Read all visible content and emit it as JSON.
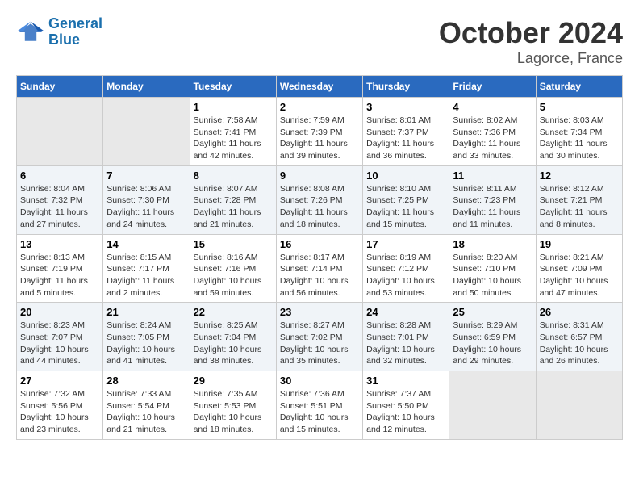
{
  "header": {
    "logo_line1": "General",
    "logo_line2": "Blue",
    "month": "October 2024",
    "location": "Lagorce, France"
  },
  "weekdays": [
    "Sunday",
    "Monday",
    "Tuesday",
    "Wednesday",
    "Thursday",
    "Friday",
    "Saturday"
  ],
  "weeks": [
    [
      {
        "day": "",
        "content": ""
      },
      {
        "day": "",
        "content": ""
      },
      {
        "day": "1",
        "content": "Sunrise: 7:58 AM\nSunset: 7:41 PM\nDaylight: 11 hours and 42 minutes."
      },
      {
        "day": "2",
        "content": "Sunrise: 7:59 AM\nSunset: 7:39 PM\nDaylight: 11 hours and 39 minutes."
      },
      {
        "day": "3",
        "content": "Sunrise: 8:01 AM\nSunset: 7:37 PM\nDaylight: 11 hours and 36 minutes."
      },
      {
        "day": "4",
        "content": "Sunrise: 8:02 AM\nSunset: 7:36 PM\nDaylight: 11 hours and 33 minutes."
      },
      {
        "day": "5",
        "content": "Sunrise: 8:03 AM\nSunset: 7:34 PM\nDaylight: 11 hours and 30 minutes."
      }
    ],
    [
      {
        "day": "6",
        "content": "Sunrise: 8:04 AM\nSunset: 7:32 PM\nDaylight: 11 hours and 27 minutes."
      },
      {
        "day": "7",
        "content": "Sunrise: 8:06 AM\nSunset: 7:30 PM\nDaylight: 11 hours and 24 minutes."
      },
      {
        "day": "8",
        "content": "Sunrise: 8:07 AM\nSunset: 7:28 PM\nDaylight: 11 hours and 21 minutes."
      },
      {
        "day": "9",
        "content": "Sunrise: 8:08 AM\nSunset: 7:26 PM\nDaylight: 11 hours and 18 minutes."
      },
      {
        "day": "10",
        "content": "Sunrise: 8:10 AM\nSunset: 7:25 PM\nDaylight: 11 hours and 15 minutes."
      },
      {
        "day": "11",
        "content": "Sunrise: 8:11 AM\nSunset: 7:23 PM\nDaylight: 11 hours and 11 minutes."
      },
      {
        "day": "12",
        "content": "Sunrise: 8:12 AM\nSunset: 7:21 PM\nDaylight: 11 hours and 8 minutes."
      }
    ],
    [
      {
        "day": "13",
        "content": "Sunrise: 8:13 AM\nSunset: 7:19 PM\nDaylight: 11 hours and 5 minutes."
      },
      {
        "day": "14",
        "content": "Sunrise: 8:15 AM\nSunset: 7:17 PM\nDaylight: 11 hours and 2 minutes."
      },
      {
        "day": "15",
        "content": "Sunrise: 8:16 AM\nSunset: 7:16 PM\nDaylight: 10 hours and 59 minutes."
      },
      {
        "day": "16",
        "content": "Sunrise: 8:17 AM\nSunset: 7:14 PM\nDaylight: 10 hours and 56 minutes."
      },
      {
        "day": "17",
        "content": "Sunrise: 8:19 AM\nSunset: 7:12 PM\nDaylight: 10 hours and 53 minutes."
      },
      {
        "day": "18",
        "content": "Sunrise: 8:20 AM\nSunset: 7:10 PM\nDaylight: 10 hours and 50 minutes."
      },
      {
        "day": "19",
        "content": "Sunrise: 8:21 AM\nSunset: 7:09 PM\nDaylight: 10 hours and 47 minutes."
      }
    ],
    [
      {
        "day": "20",
        "content": "Sunrise: 8:23 AM\nSunset: 7:07 PM\nDaylight: 10 hours and 44 minutes."
      },
      {
        "day": "21",
        "content": "Sunrise: 8:24 AM\nSunset: 7:05 PM\nDaylight: 10 hours and 41 minutes."
      },
      {
        "day": "22",
        "content": "Sunrise: 8:25 AM\nSunset: 7:04 PM\nDaylight: 10 hours and 38 minutes."
      },
      {
        "day": "23",
        "content": "Sunrise: 8:27 AM\nSunset: 7:02 PM\nDaylight: 10 hours and 35 minutes."
      },
      {
        "day": "24",
        "content": "Sunrise: 8:28 AM\nSunset: 7:01 PM\nDaylight: 10 hours and 32 minutes."
      },
      {
        "day": "25",
        "content": "Sunrise: 8:29 AM\nSunset: 6:59 PM\nDaylight: 10 hours and 29 minutes."
      },
      {
        "day": "26",
        "content": "Sunrise: 8:31 AM\nSunset: 6:57 PM\nDaylight: 10 hours and 26 minutes."
      }
    ],
    [
      {
        "day": "27",
        "content": "Sunrise: 7:32 AM\nSunset: 5:56 PM\nDaylight: 10 hours and 23 minutes."
      },
      {
        "day": "28",
        "content": "Sunrise: 7:33 AM\nSunset: 5:54 PM\nDaylight: 10 hours and 21 minutes."
      },
      {
        "day": "29",
        "content": "Sunrise: 7:35 AM\nSunset: 5:53 PM\nDaylight: 10 hours and 18 minutes."
      },
      {
        "day": "30",
        "content": "Sunrise: 7:36 AM\nSunset: 5:51 PM\nDaylight: 10 hours and 15 minutes."
      },
      {
        "day": "31",
        "content": "Sunrise: 7:37 AM\nSunset: 5:50 PM\nDaylight: 10 hours and 12 minutes."
      },
      {
        "day": "",
        "content": ""
      },
      {
        "day": "",
        "content": ""
      }
    ]
  ]
}
